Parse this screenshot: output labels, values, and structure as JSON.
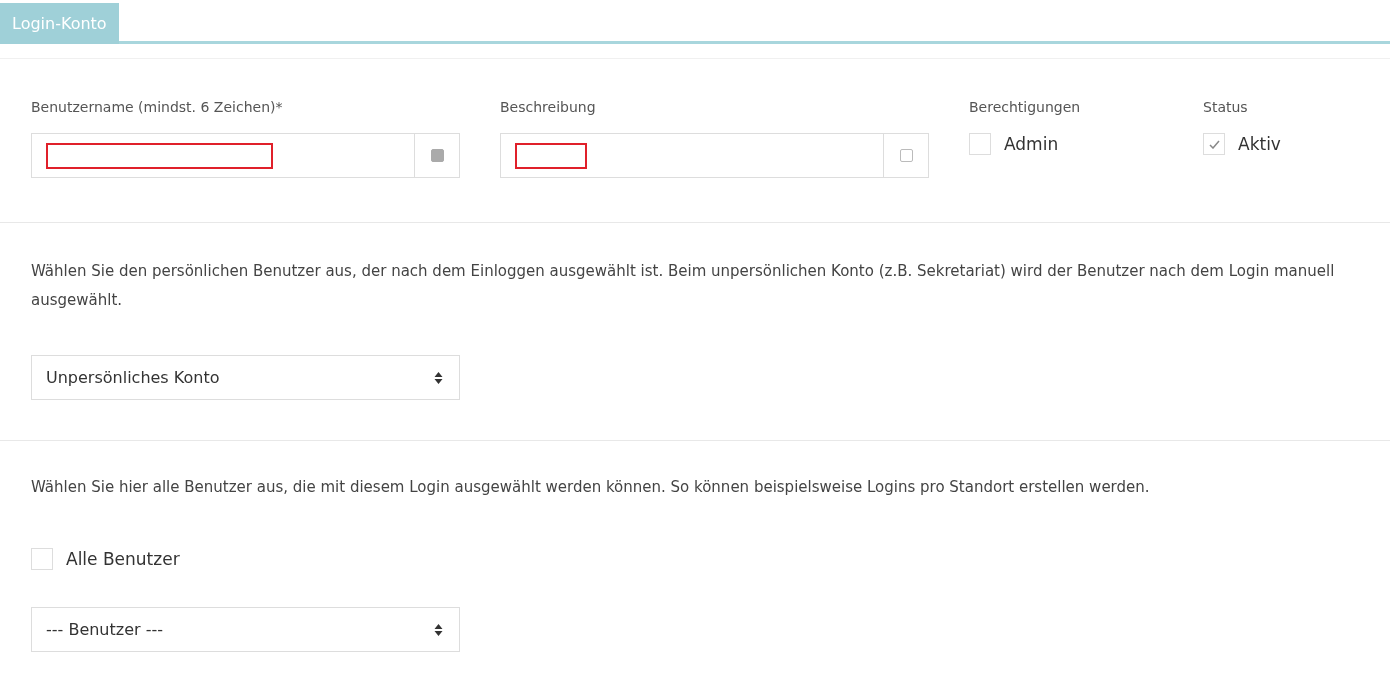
{
  "tabs": [
    {
      "label": "Login-Konto",
      "selected": true
    }
  ],
  "fields": [
    {
      "label": "Benutzername (mindst. 6 Zeichen)*",
      "redacted": true,
      "addon_checked": true
    },
    {
      "label": "Beschreibung",
      "redacted": true,
      "addon_checked": false
    }
  ],
  "permissions": {
    "label": "Berechtigungen",
    "option": {
      "label": "Admin",
      "checked": false
    }
  },
  "status": {
    "label": "Status",
    "option": {
      "label": "Aktiv",
      "checked": true
    }
  },
  "personal_user": {
    "hint": "Wählen Sie den persönlichen Benutzer aus, der nach dem Einloggen ausgewählt ist. Beim unpersönlichen Konto (z.B. Sekretariat) wird der Benutzer nach dem Login manuell ausgewählt.",
    "select": "Unpersönliches Konto"
  },
  "users": {
    "hint": "Wählen Sie hier alle Benutzer aus, die mit diesem Login ausgewählt werden können. So können beispielsweise Logins pro Standort erstellen werden.",
    "all_users": {
      "label": "Alle Benutzer",
      "checked": false
    },
    "select": "--- Benutzer ---"
  }
}
